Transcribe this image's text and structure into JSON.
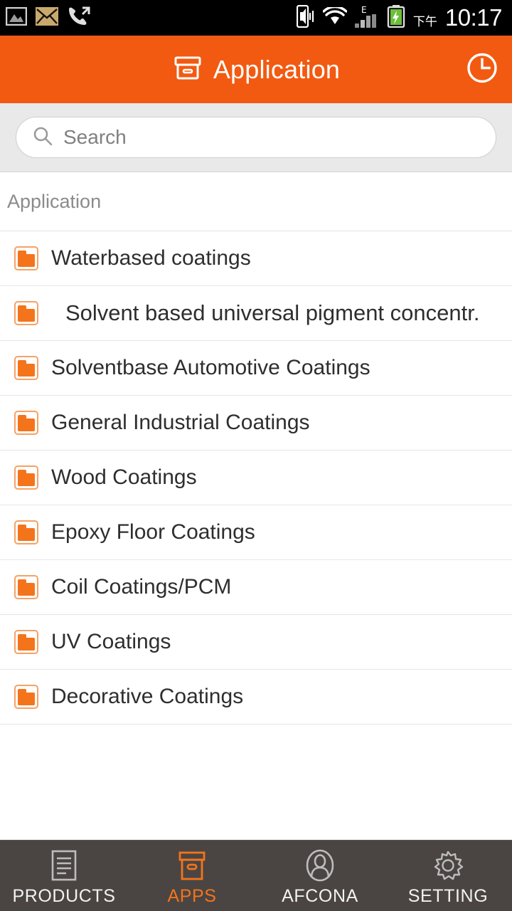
{
  "statusbar": {
    "left_icons": [
      "gallery-icon",
      "email-icon",
      "outgoing-call-icon"
    ],
    "right_icons": [
      "vibrate-icon",
      "wifi-icon",
      "edge-signal-icon",
      "battery-charging-icon"
    ],
    "signal_type": "E",
    "ampm": "下午",
    "time": "10:17"
  },
  "header": {
    "icon": "archive-box-icon",
    "title": "Application",
    "right_icon": "clock-icon"
  },
  "search": {
    "icon": "search-icon",
    "placeholder": "Search"
  },
  "section": {
    "label": "Application"
  },
  "list": {
    "items": [
      {
        "icon": "folder-icon",
        "label": "Waterbased coatings",
        "indent": false
      },
      {
        "icon": "folder-icon",
        "label": "Solvent based universal pigment concentr.",
        "indent": true
      },
      {
        "icon": "folder-icon",
        "label": "Solventbase Automotive Coatings",
        "indent": false
      },
      {
        "icon": "folder-icon",
        "label": "General Industrial Coatings",
        "indent": false
      },
      {
        "icon": "folder-icon",
        "label": "Wood Coatings",
        "indent": false
      },
      {
        "icon": "folder-icon",
        "label": "Epoxy Floor Coatings",
        "indent": false
      },
      {
        "icon": "folder-icon",
        "label": "Coil Coatings/PCM",
        "indent": false
      },
      {
        "icon": "folder-icon",
        "label": "UV Coatings",
        "indent": false
      },
      {
        "icon": "folder-icon",
        "label": "Decorative Coatings",
        "indent": false
      }
    ]
  },
  "bottomnav": {
    "items": [
      {
        "icon": "document-icon",
        "label": "PRODUCTS",
        "active": false
      },
      {
        "icon": "archive-box-icon",
        "label": "APPS",
        "active": true
      },
      {
        "icon": "person-circle-icon",
        "label": "AFCONA",
        "active": false
      },
      {
        "icon": "gear-icon",
        "label": "SETTING",
        "active": false
      }
    ]
  },
  "colors": {
    "accent_orange": "#F25A11",
    "icon_orange": "#F4741B",
    "nav_background": "#4A4543",
    "statusbar_background": "#000000",
    "search_background": "#E9E9E9"
  }
}
